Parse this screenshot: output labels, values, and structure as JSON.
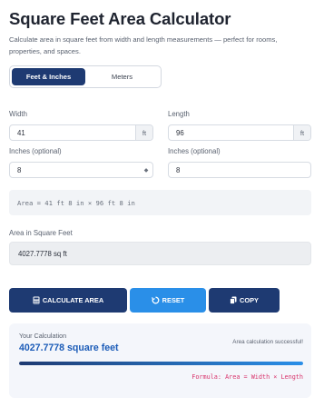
{
  "header": {
    "title": "Square Feet Area Calculator",
    "description": "Calculate area in square feet from width and length measurements — perfect for rooms, properties, and spaces."
  },
  "unit_toggle": {
    "options": [
      "Feet & Inches",
      "Meters"
    ],
    "selected": "Feet & Inches"
  },
  "width": {
    "label": "Width",
    "value": "41",
    "unit": "ft"
  },
  "length": {
    "label": "Length",
    "value": "96",
    "unit": "ft"
  },
  "width_inches": {
    "label": "Inches (optional)",
    "value": "8"
  },
  "length_inches": {
    "label": "Inches (optional)",
    "value": "8"
  },
  "preview": "Area = 41 ft 8 in × 96 ft 8 in",
  "result": {
    "label": "Area in Square Feet",
    "value": "4027.7778 sq ft"
  },
  "buttons": {
    "calculate": "CALCULATE AREA",
    "reset": "RESET",
    "copy": "COPY"
  },
  "calculation": {
    "title": "Your Calculation",
    "value": "4027.7778 square feet",
    "status": "Area calculation successful!",
    "progress": 1.0,
    "formula": "Formula: Area = Width × Length"
  },
  "colors": {
    "primary": "#1e3a72",
    "accent": "#2a8fe8",
    "result_text": "#1c5cb8",
    "formula": "#d8336b"
  },
  "icons": {
    "calculate": "calculator-icon",
    "reset": "reset-icon",
    "copy": "copy-icon",
    "spinner": "spinner-arrows-icon"
  }
}
